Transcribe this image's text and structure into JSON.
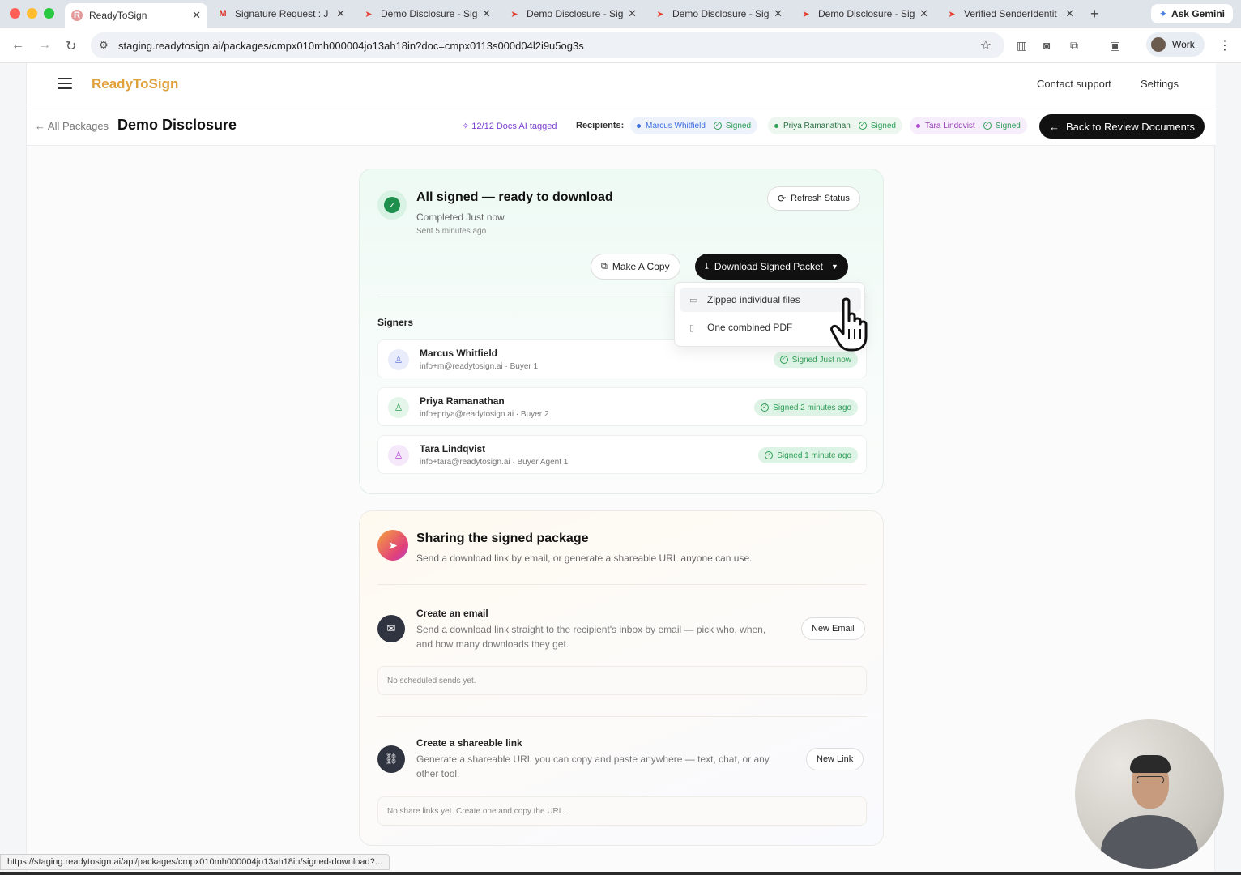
{
  "browser": {
    "tabs": [
      {
        "title": "ReadyToSign",
        "active": true
      },
      {
        "title": "Signature Request : J"
      },
      {
        "title": "Demo Disclosure - Sig"
      },
      {
        "title": "Demo Disclosure - Sig"
      },
      {
        "title": "Demo Disclosure - Sig"
      },
      {
        "title": "Demo Disclosure - Sig"
      },
      {
        "title": "Verified SenderIdentit"
      }
    ],
    "gemini_label": "Ask Gemini",
    "url": "staging.readytosign.ai/packages/cmpx010mh000004jo13ah18in?doc=cmpx0113s000d04l2i9u5og3s",
    "profile_label": "Work",
    "status_url": "https://staging.readytosign.ai/api/packages/cmpx010mh000004jo13ah18in/signed-download?..."
  },
  "app": {
    "brand": "ReadyToSign",
    "contact_support": "Contact support",
    "settings": "Settings"
  },
  "subheader": {
    "back_label": "All Packages",
    "title": "Demo Disclosure",
    "ai_tagged": "12/12 Docs AI tagged",
    "recipients_label": "Recipients:",
    "recipients": [
      {
        "name": "Marcus Whitfield",
        "status": "Signed",
        "color": "#3b6fe0"
      },
      {
        "name": "Priya Ramanathan",
        "status": "Signed",
        "color": "#2f9e55"
      },
      {
        "name": "Tara Lindqvist",
        "status": "Signed",
        "color": "#b04ad0"
      }
    ],
    "back_review": "Back to Review Documents"
  },
  "status_card": {
    "title": "All signed — ready to download",
    "completed": "Completed Just now",
    "sent": "Sent 5 minutes ago",
    "refresh": "Refresh Status",
    "make_copy": "Make A Copy",
    "download": "Download Signed Packet",
    "signers_label": "Signers",
    "signers": [
      {
        "name": "Marcus Whitfield",
        "meta": "info+m@readytosign.ai · Buyer 1",
        "status": "Signed Just now",
        "color": "#6b7fd6",
        "bg": "#e9edfb"
      },
      {
        "name": "Priya Ramanathan",
        "meta": "info+priya@readytosign.ai · Buyer 2",
        "status": "Signed 2 minutes ago",
        "color": "#2f9e55",
        "bg": "#e4f5ea"
      },
      {
        "name": "Tara Lindqvist",
        "meta": "info+tara@readytosign.ai · Buyer Agent 1",
        "status": "Signed 1 minute ago",
        "color": "#b04ad0",
        "bg": "#f5e8fa"
      }
    ]
  },
  "download_menu": {
    "items": [
      {
        "label": "Zipped individual files",
        "icon": "archive-icon"
      },
      {
        "label": "One combined PDF",
        "icon": "file-icon"
      }
    ]
  },
  "share_card": {
    "title": "Sharing the signed package",
    "subtitle": "Send a download link by email, or generate a shareable URL anyone can use.",
    "email": {
      "title": "Create an email",
      "desc": "Send a download link straight to the recipient's inbox by email — pick who, when, and how many downloads they get.",
      "button": "New Email",
      "empty": "No scheduled sends yet."
    },
    "link": {
      "title": "Create a shareable link",
      "desc": "Generate a shareable URL you can copy and paste anywhere — text, chat, or any other tool.",
      "button": "New Link",
      "empty": "No share links yet. Create one and copy the URL."
    }
  }
}
